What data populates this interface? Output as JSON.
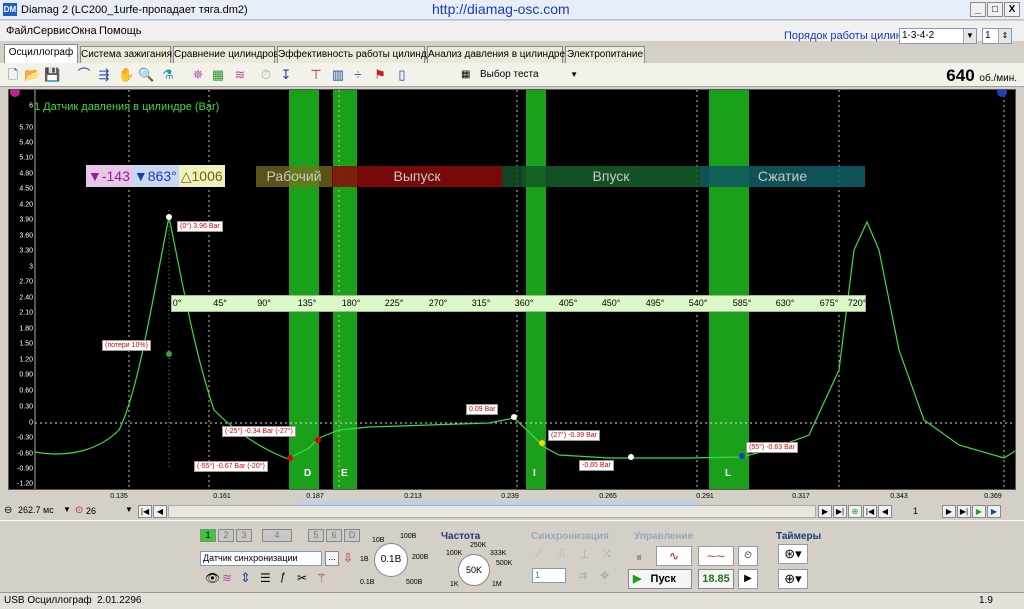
{
  "window": {
    "title": "Diamag 2 (LC200_1urfe-пропадает тяга.dm2)",
    "url": "http://diamag-osc.com",
    "app_icon": "DM",
    "btn_min": "_",
    "btn_max": "□",
    "btn_close": "X"
  },
  "menu": [
    "Файл",
    "Сервис",
    "Окна",
    "Помощь"
  ],
  "cylinder_order": {
    "label": "Порядок работы цилиндров",
    "value": "1-3-4-2",
    "cylinder": "1"
  },
  "tabs": [
    "Осциллограф",
    "Система зажигания",
    "Сравнение цилиндров",
    "Эффективность работы цилиндров",
    "Анализ давления в цилиндре",
    "Электропитание"
  ],
  "toolbar": {
    "test_select": "Выбор теста",
    "rpm": "640",
    "rpm_unit": "об./мин."
  },
  "scope": {
    "channel_label": "1 Датчик давления в цилиндре (Bar)",
    "y_ticks": [
      "6",
      "5.70",
      "5.40",
      "5.10",
      "4.80",
      "4.50",
      "4.20",
      "3.90",
      "3.60",
      "3.30",
      "3",
      "2.70",
      "2.40",
      "2.10",
      "1.80",
      "1.50",
      "1.20",
      "0.90",
      "0.60",
      "0.30",
      "0",
      "-0.30",
      "-0.60",
      "-0.90",
      "-1.20"
    ],
    "cursor_readout": {
      "left": "-143",
      "right": "863°",
      "delta": "1006"
    },
    "phases": [
      "Рабочий",
      "Выпуск",
      "Впуск",
      "Сжатие"
    ],
    "angle_scale": [
      "0°",
      "45°",
      "90°",
      "135°",
      "180°",
      "225°",
      "270°",
      "315°",
      "360°",
      "405°",
      "450°",
      "495°",
      "540°",
      "585°",
      "630°",
      "675°",
      "720°"
    ],
    "markers": [
      "D",
      "E",
      "I",
      "L"
    ],
    "data_labels": [
      "(0°) 3.96 Bar",
      "(потери 10%)",
      "(-25°) -0.34 Bar (-27°)",
      "(-55°) -0.67 Bar (-20°)",
      "0.09 Bar",
      "(27°) -0.39 Bar",
      "-0.65 Bar",
      "(55°) -0.63 Bar"
    ],
    "x_ticks": [
      "0.135",
      "0.161",
      "0.187",
      "0.213",
      "0.239",
      "0.265",
      "0.291",
      "0.317",
      "0.343",
      "0.369"
    ]
  },
  "nav": {
    "timebase": "262.7 мс",
    "channel": "26",
    "page": "1"
  },
  "channels": [
    "1",
    "2",
    "3",
    "4",
    "5",
    "6",
    "D"
  ],
  "sensor": {
    "label": "Датчик синхронизации",
    "dots": "...",
    "knob": "0.1В",
    "range_labels": [
      "10В",
      "100В",
      "1В",
      "200В",
      "0.1В",
      "500В"
    ]
  },
  "frequency": {
    "title": "Частота",
    "knob": "50K",
    "labels": [
      "250K",
      "100K",
      "333K",
      "500K",
      "1K",
      "1M"
    ]
  },
  "sync": {
    "title": "Синхронизация",
    "channel": "1"
  },
  "control": {
    "title": "Управление",
    "start": "Пуск",
    "counter": "18.85"
  },
  "timers": {
    "title": "Таймеры"
  },
  "status": {
    "device": "USB Осциллограф",
    "version": "2.01.2296",
    "zoom": "1.9"
  }
}
